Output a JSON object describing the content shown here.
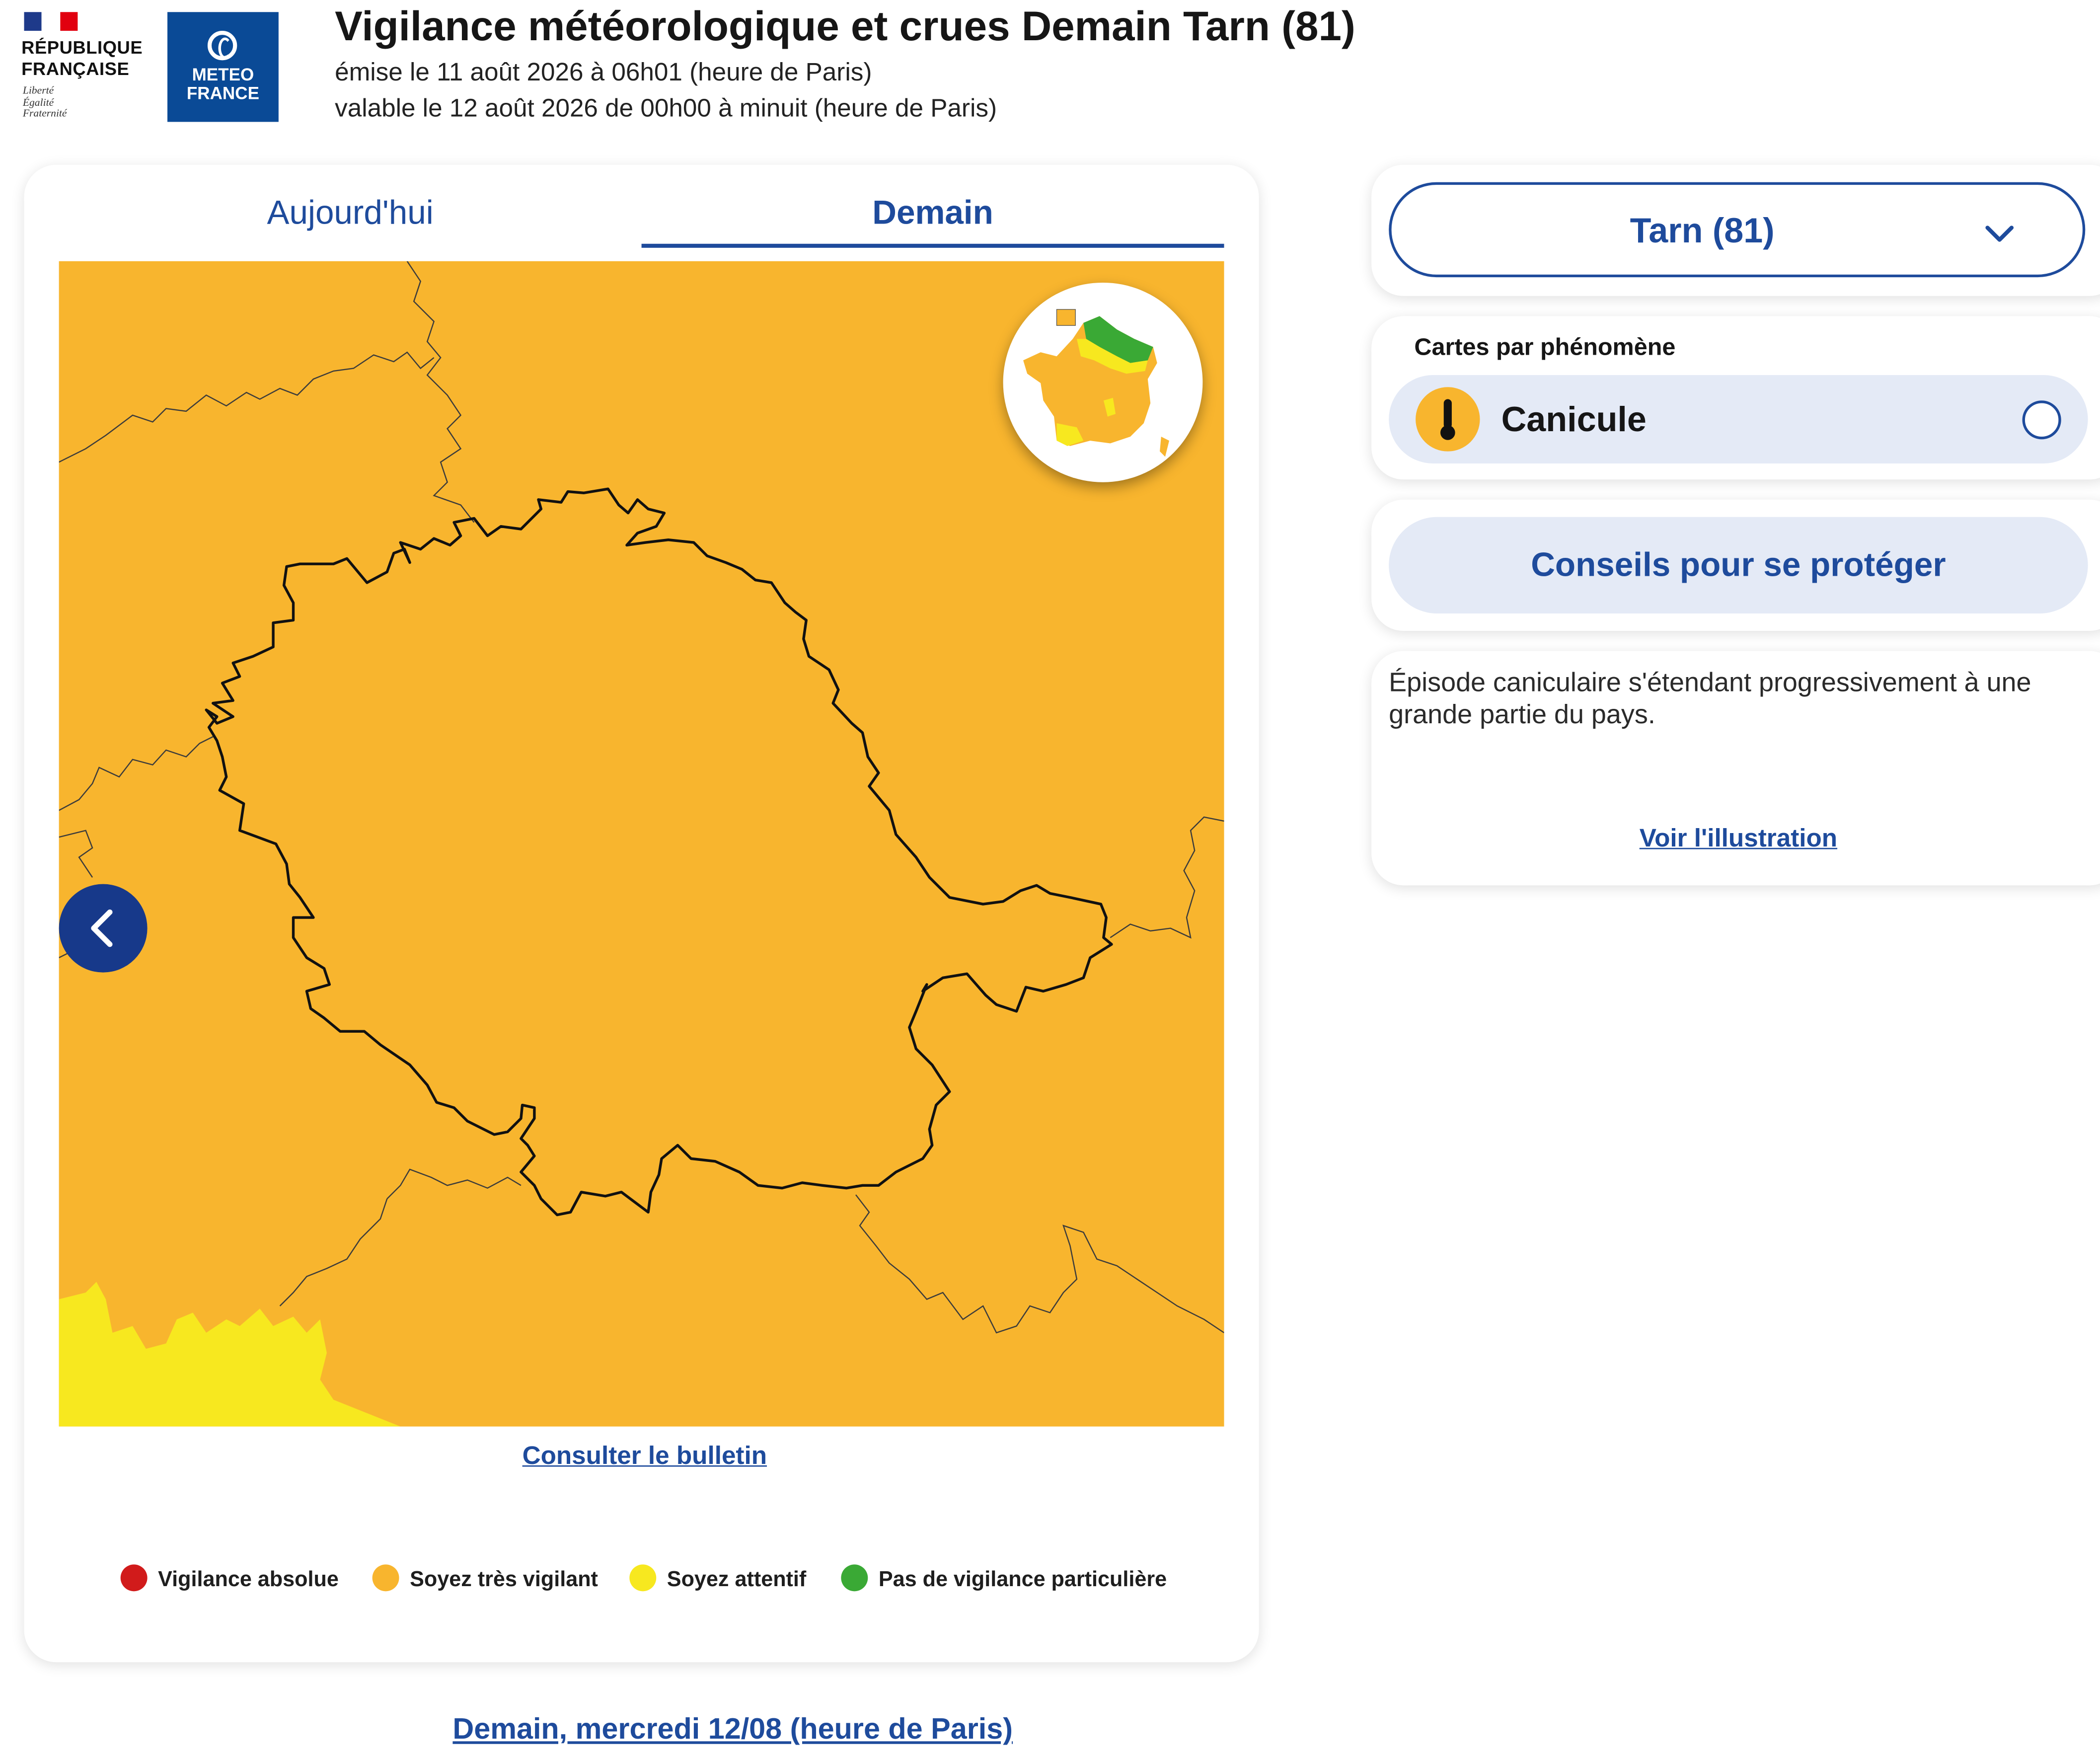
{
  "header": {
    "republique_lines": [
      "RÉPUBLIQUE",
      "FRANÇAISE"
    ],
    "motto_lines": [
      "Liberté",
      "Égalité",
      "Fraternité"
    ],
    "meteo_lines": [
      "METEO",
      "FRANCE"
    ],
    "title": "Vigilance météorologique et crues Demain Tarn (81)",
    "issued": "émise le 11 août 2026 à 06h01 (heure de Paris)",
    "valid": "valable le 12 août 2026 de 00h00 à minuit (heure de Paris)"
  },
  "tabs": {
    "today": "Aujourd'hui",
    "tomorrow": "Demain",
    "active": "tomorrow"
  },
  "map": {
    "department_level": "orange",
    "prev_icon": "chevron-left-icon",
    "bulletin_link": "Consulter le bulletin"
  },
  "legend": [
    {
      "label": "Vigilance absolue",
      "color": "#d11b1b"
    },
    {
      "label": "Soyez très vigilant",
      "color": "#f8b52e"
    },
    {
      "label": "Soyez attentif",
      "color": "#f7e81f"
    },
    {
      "label": "Pas de vigilance particulière",
      "color": "#3aa935"
    }
  ],
  "bottom_peek": "Demain, mercredi 12/08 (heure de Paris)",
  "department_select": {
    "value": "Tarn (81)",
    "icon": "chevron-down-icon"
  },
  "phenomena": {
    "title": "Cartes par phénomène",
    "items": [
      {
        "label": "Canicule",
        "icon": "thermometer-icon",
        "selected": false
      }
    ]
  },
  "advice_button": "Conseils pour se protéger",
  "description": {
    "text": "Épisode caniculaire s'étendant progressivement à une grande partie du pays.",
    "link": "Voir l'illustration"
  },
  "colors": {
    "accent": "#1e4b9c",
    "orange": "#f8b52e",
    "yellow": "#f7e81f",
    "green": "#3aa935",
    "red": "#d11b1b",
    "button_bg": "#e4eaf6"
  }
}
